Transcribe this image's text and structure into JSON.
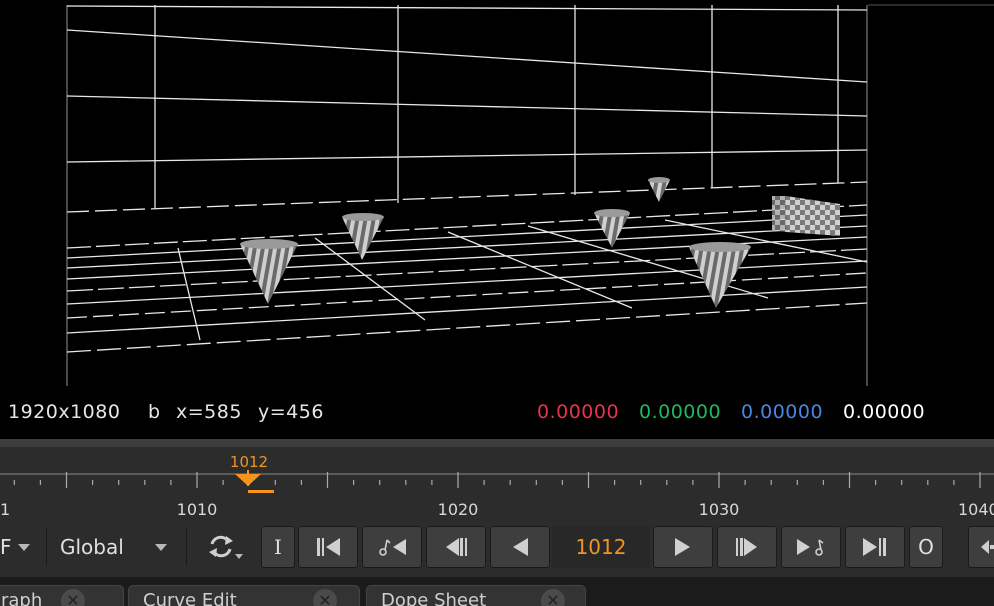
{
  "viewer": {
    "resolution": "1920x1080",
    "channel": "b",
    "cursor_x": "x=585",
    "cursor_y": "y=456",
    "pixel_values": {
      "r": "0.00000",
      "g": "0.00000",
      "b": "0.00000",
      "a": "0.00000"
    },
    "colors": {
      "r": "#e8334a",
      "g": "#1fb85c",
      "b": "#4a86e0",
      "a": "#ffffff"
    }
  },
  "timeline": {
    "current_frame": "1012",
    "tick_labels": [
      "1",
      "1010",
      "1020",
      "1030",
      "1040"
    ],
    "playhead_color": "#f3941f"
  },
  "transport": {
    "fps_label": "F",
    "scope_label": "Global",
    "in_label": "I",
    "out_label": "O",
    "frame_value": "1012",
    "icons": [
      "fps-dropdown-icon",
      "loop-mode-icon",
      "first-frame-icon",
      "prev-keyframe-icon",
      "step-back-icon",
      "play-backward-icon",
      "play-forward-icon",
      "step-forward-icon",
      "next-keyframe-icon",
      "last-frame-icon",
      "more-icon"
    ]
  },
  "tabs": [
    {
      "label": "raph"
    },
    {
      "label": "Curve Edit"
    },
    {
      "label": "Dope Sheet"
    }
  ]
}
